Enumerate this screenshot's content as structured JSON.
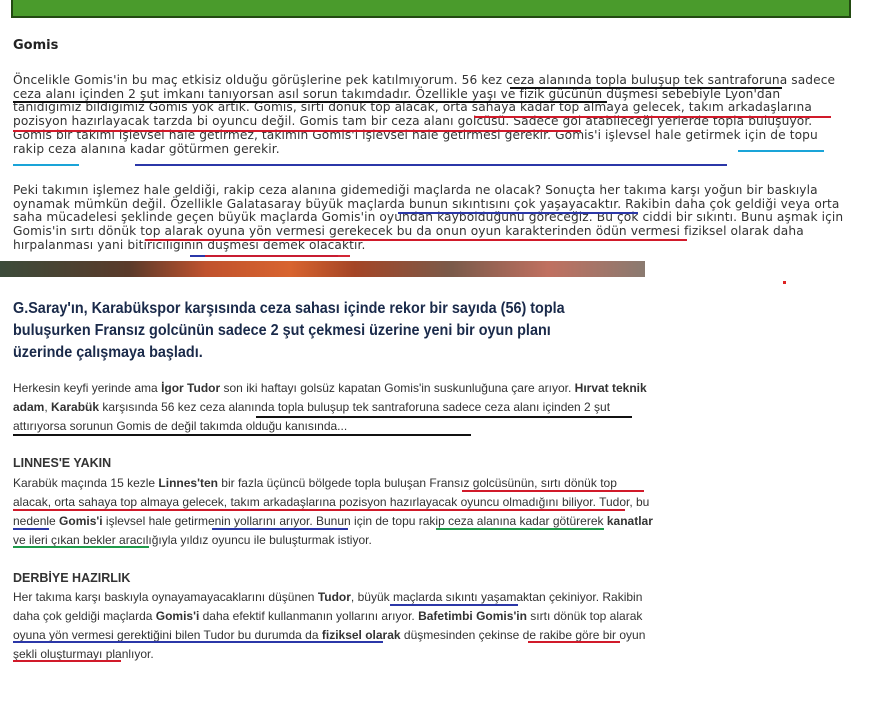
{
  "blog": {
    "heading": "Gomis",
    "p1": "Öncelikle Gomis'in bu maç etkisiz olduğu görüşlerine pek katılmıyorum. 56 kez ceza alanında topla buluşup tek santraforuna sadece ceza alanı içinden 2 şut imkanı tanıyorsan asıl sorun takımdadır. Özellikle yaşı ve fizik gücünün düşmesi sebebiyle Lyon'dan tanıdığımız bildiğimiz Gomis yok artık. Gomis, sırtı dönük top alacak, orta sahaya kadar top almaya gelecek, takım arkadaşlarına pozisyon hazırlayacak tarzda bi oyuncu değil. Gomis tam bir ceza alanı golcüsü. Sadece gol atabileceği yerlerde topla buluşuyor. Gomis bir takımı işlevsel hale getirmez, takımın Gomis'i işlevsel hale getirmesi gerekir. Gomis'i işlevsel hale getirmek için de topu rakip ceza alanına kadar götürmen gerekir.",
    "p2": "Peki takımın işlemez hale geldiği, rakip ceza alanına gidemediği maçlarda ne olacak? Sonuçta her takıma karşı yoğun bir baskıyla oynamak mümkün değil. Özellikle Galatasaray büyük maçlarda bunun sıkıntısını çok yaşayacaktır. Rakibin daha çok geldiği veya orta saha mücadelesi şeklinde geçen büyük maçlarda Gomis'in oyundan kaybolduğunu göreceğiz. Bu çok ciddi bir sıkıntı. Bunu aşmak için Gomis'in sırtı dönük top alarak oyuna yön vermesi gerekecek bu da onun oyun karakterinden ödün vermesi fiziksel olarak daha hırpalanması yani bitiriciliğinin düşmesi demek olacaktır."
  },
  "news": {
    "headline": "G.Saray'ın, Karabükspor karşısında ceza sahası içinde rekor bir sayıda (56) topla buluşurken Fransız golcünün sadece 2 şut çekmesi üzerine yeni bir oyun planı üzerinde çalışmaya başladı.",
    "intro": {
      "t1": "Herkesin keyfi yerinde ama ",
      "b1": "İgor Tudor",
      "t2": " son iki haftayı golsüz kapatan Gomis'in suskunluğuna çare arıyor. ",
      "b2": "Hırvat teknik adam",
      "t3": ", ",
      "b3": "Karabük",
      "t4": " karşısında 56 kez ceza alanında topla buluşup tek santraforuna sadece ceza alanı içinden 2 şut attırıyorsa sorunun Gomis de değil takımda olduğu kanısında..."
    },
    "section1": {
      "heading": "LINNES'E YAKIN",
      "t1": "Karabük maçında 15 kezle ",
      "b1": "Linnes'ten",
      "t2": " bir fazla üçüncü bölgede topla buluşan Fransız golcüsünün, sırtı dönük top alacak, orta sahaya top almaya gelecek, takım arkadaşlarına pozisyon hazırlayacak oyuncu olmadığını biliyor. Tudor, bu nedenle ",
      "b2": "Gomis'i",
      "t3": " işlevsel hale getirmenin yollarını arıyor. Bunun için de topu rakip ceza alanına kadar götürerek ",
      "b3": "kanatlar",
      "t4": " ve ileri çıkan bekler aracılığıyla yıldız oyuncu ile buluşturmak istiyor."
    },
    "section2": {
      "heading": "DERBİYE HAZIRLIK",
      "t1": "Her takıma karşı baskıyla oynayamayacaklarını düşünen ",
      "b1": "Tudor",
      "t2": ", büyük maçlarda sıkıntı yaşamaktan çekiniyor. Rakibin daha çok geldiği maçlarda ",
      "b2": "Gomis'i",
      "t3": " daha efektif kullanmanın yollarını arıyor. ",
      "b3": "Bafetimbi Gomis'in",
      "t4": " sırtı dönük top alarak oyuna yön vermesi gerektiğini bilen Tudor bu durumda da ",
      "b4": "fiziksel olarak",
      "t5": " düşmesinden çekinse de rakibe göre bir oyun şekli oluşturmayı planlıyor."
    }
  },
  "colors": {
    "underline_black": "#111111",
    "underline_red": "#d11a2a",
    "underline_blue": "#2b37a8",
    "underline_cyan": "#1aa4d8",
    "underline_green": "#1e9a4a",
    "headline": "#1a2a4a"
  }
}
